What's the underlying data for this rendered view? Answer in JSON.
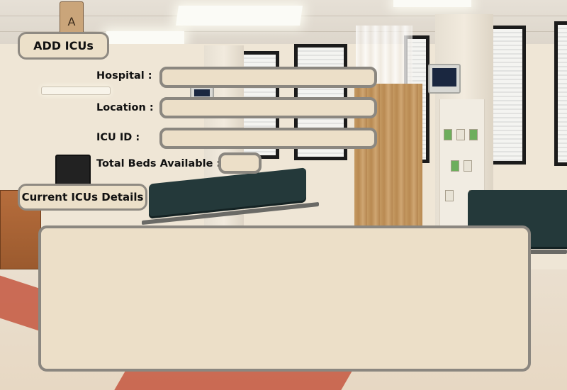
{
  "header": {
    "add_icus_label": "ADD ICUs"
  },
  "form": {
    "hospital": {
      "label": "Hospital :",
      "value": "",
      "placeholder": ""
    },
    "location": {
      "label": "Location :",
      "value": "",
      "placeholder": ""
    },
    "icu_id": {
      "label": "ICU ID :",
      "value": "",
      "placeholder": ""
    },
    "total_beds": {
      "label": "Total Beds Available :",
      "value": "",
      "placeholder": ""
    }
  },
  "details": {
    "title": "Current ICUs Details"
  },
  "background": {
    "sign_letter": "A"
  },
  "colors": {
    "panel_fill": "#ecdfc8",
    "panel_border": "#8b8780"
  }
}
